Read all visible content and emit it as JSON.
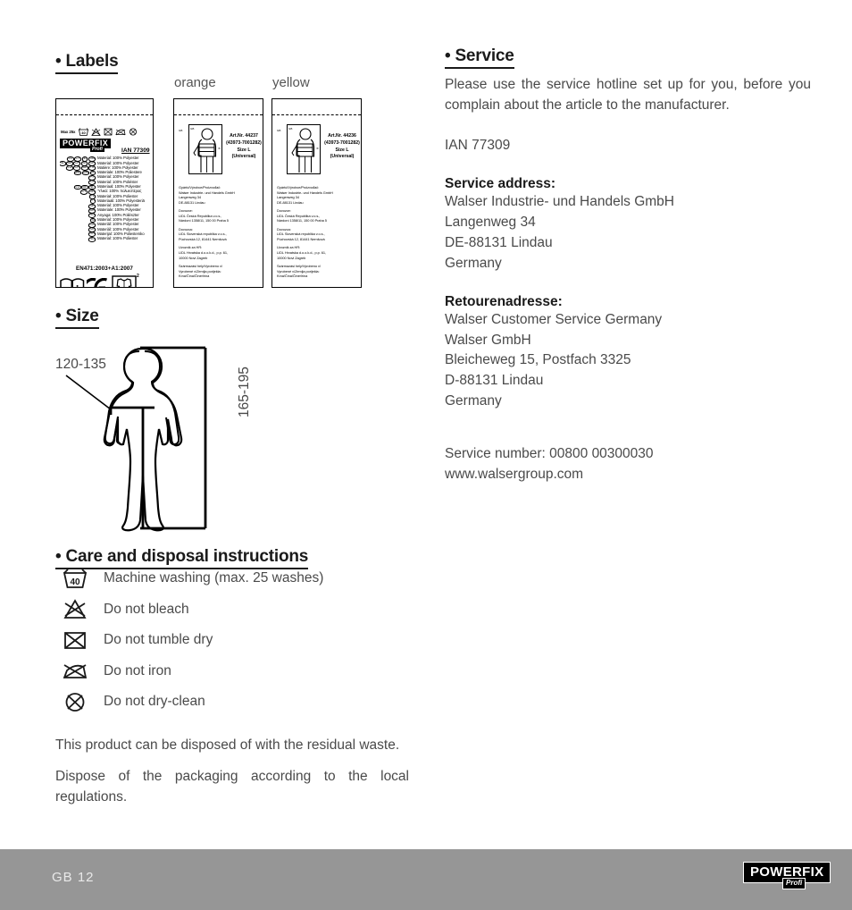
{
  "sections": {
    "labels": {
      "bullet": "•",
      "title": "Labels"
    },
    "size": {
      "bullet": "•",
      "title": "Size"
    },
    "care": {
      "bullet": "•",
      "title": "Care and disposal instructions"
    },
    "service": {
      "bullet": "•",
      "title": "Service"
    }
  },
  "label_captions": {
    "orange": "orange",
    "yellow": "yellow"
  },
  "label_left": {
    "max_washes": "Max 25x",
    "wash_temp": "40",
    "brand": "POWERFIX",
    "sub_brand": "Profi",
    "ian": "IAN 77309",
    "standard": "EN471:2003+A1:2007",
    "class_marks": {
      "top": "2",
      "bottom": "2"
    },
    "materials": [
      {
        "flags": "GB IE CY MT",
        "text": "Material: 100% Polyester"
      },
      {
        "flags": "DE AT CH BE NL LU",
        "text": "Material: 100% Polyester"
      },
      {
        "flags": "FR BE CH LU",
        "text": "Matière: 100% Polyester"
      },
      {
        "flags": "IT CH MT",
        "text": "Materiale: 100% Poliestere"
      },
      {
        "flags": "PT",
        "text": "Material: 100% Polyester"
      },
      {
        "flags": "ES",
        "text": "Material: 100% Poliéster"
      },
      {
        "flags": "NL BE LU",
        "text": "Materiaal: 100% Polyester"
      },
      {
        "flags": "GR CY",
        "text": "Ύλικό: 100% πολυεστέρας"
      },
      {
        "flags": "PL",
        "text": "Materiał: 100% Poliester"
      },
      {
        "flags": "FI",
        "text": "Materiaali: 100% Polyesteriä"
      },
      {
        "flags": "SE",
        "text": "Material: 100% Polyester"
      },
      {
        "flags": "DK",
        "text": "Materiale: 100% Polyester"
      },
      {
        "flags": "HU",
        "text": "Anyaga: 100% Poliészter"
      },
      {
        "flags": "SI",
        "text": "Material: 100% Polyester"
      },
      {
        "flags": "CZ",
        "text": "Materiál: 100% Polyester"
      },
      {
        "flags": "SK",
        "text": "Materiál: 100% Polyester"
      },
      {
        "flags": "HR",
        "text": "Materijal: 100% Poliestersko"
      },
      {
        "flags": "RO",
        "text": "Material: 100% Poliester"
      }
    ]
  },
  "label_middle": {
    "color": "orange",
    "art_no": "Art.Nr. 44237",
    "art_code": "(43973-7001282)",
    "size": "Size L",
    "size_note": "(Universal)",
    "pictogram_marks": {
      "left": "GB",
      "top": "GB",
      "right": "III"
    },
    "manufacturer_title": "Gyártó/Výrobce/Proizvođač:",
    "manufacturer_lines": [
      "Walser Industrie- und Handels GmbH",
      "Langenweg 34",
      "DE-88131 Lindau"
    ],
    "importer_cz_title": "Dovozce:",
    "importer_cz_lines": [
      "LIDL Česká Republika v.o.s.,",
      "Nárdoní 1358/11, 150 00 Praha 5"
    ],
    "importer_sk_title": "Dovozca:",
    "importer_sk_lines": [
      "LIDL Slovenská republika v.o.s.,",
      "Púchovská 12, 81441 Nemšová"
    ],
    "importer_hr_title": "Uvoznik za HR:",
    "importer_hr_lines": [
      "LIDL Hrvatska d.o.o.k.d., p.p. 61,",
      "10000 Novi Zagreb"
    ],
    "origin_title": "Származási hely/Vyrobeno v/",
    "origin_lines": [
      "Vyrobené v/Zemlja porijekla:",
      "Kína/Čína/Činerlrína"
    ]
  },
  "label_right": {
    "color": "yellow",
    "art_no": "Art.Nr. 44236",
    "art_code": "(43973-7001282)",
    "size": "Size L",
    "size_note": "(Universal)",
    "pictogram_marks": {
      "left": "GB",
      "top": "GB",
      "right": "III"
    },
    "manufacturer_title": "Gyártó/Výrobce/Proizvođač:",
    "manufacturer_lines": [
      "Walser Industrie- und Handels GmbH",
      "Langenweg 34",
      "DE-88131 Lindau"
    ],
    "importer_cz_title": "Dovozce:",
    "importer_cz_lines": [
      "LIDL Česká Republika v.o.s.,",
      "Nárdoní 1358/11, 150 00 Praha 5"
    ],
    "importer_sk_title": "Dovozca:",
    "importer_sk_lines": [
      "LIDL Slovenská republika v.o.s.,",
      "Púchovská 12, 81441 Nemšová"
    ],
    "importer_hr_title": "Uvoznik za HR:",
    "importer_hr_lines": [
      "LIDL Hrvatska d.o.o.k.d., p.p. 61,",
      "10000 Novi Zagreb"
    ],
    "origin_title": "Származási hely/Vyrobeno v/",
    "origin_lines": [
      "Vyrobené v/Zemlja porijekla:",
      "Kína/Čína/Činerlrína"
    ]
  },
  "size_figure": {
    "chest_measure": "120-135",
    "height_measure": "165-195"
  },
  "care_instructions": [
    {
      "icon": "machine-wash-40-icon",
      "text": "Machine washing (max. 25 washes)",
      "temp": "40"
    },
    {
      "icon": "do-not-bleach-icon",
      "text": "Do not bleach"
    },
    {
      "icon": "do-not-tumble-dry-icon",
      "text": "Do not tumble dry"
    },
    {
      "icon": "do-not-iron-icon",
      "text": "Do not iron"
    },
    {
      "icon": "do-not-dry-clean-icon",
      "text": "Do not dry-clean"
    }
  ],
  "disposal": {
    "line1": "This product can be disposed of with the residual waste.",
    "line2": "Dispose of the packaging according to the local regulations."
  },
  "service": {
    "intro": "Please use the service hotline set up for you, before you complain about the article to the manufacturer.",
    "ian": "IAN 77309",
    "address_title": "Service address:",
    "address_lines": [
      "Walser Industrie- und Handels GmbH",
      "Langenweg 34",
      "DE-88131 Lindau",
      "Germany"
    ],
    "return_title": "Retourenadresse:",
    "return_lines": [
      "Walser Customer Service Germany",
      "Walser GmbH",
      "Bleicheweg 15, Postfach 3325",
      "D-88131 Lindau",
      "Germany"
    ],
    "service_number": "Service number: 00800 00300030",
    "website": "www.walsergroup.com"
  },
  "footer": {
    "page_label": "GB  12",
    "brand": "POWERFIX",
    "sub_brand": "Profi"
  },
  "colors": {
    "footer_band": "#969696",
    "text": "#4a4a4a",
    "heading": "#1a1a1a"
  }
}
